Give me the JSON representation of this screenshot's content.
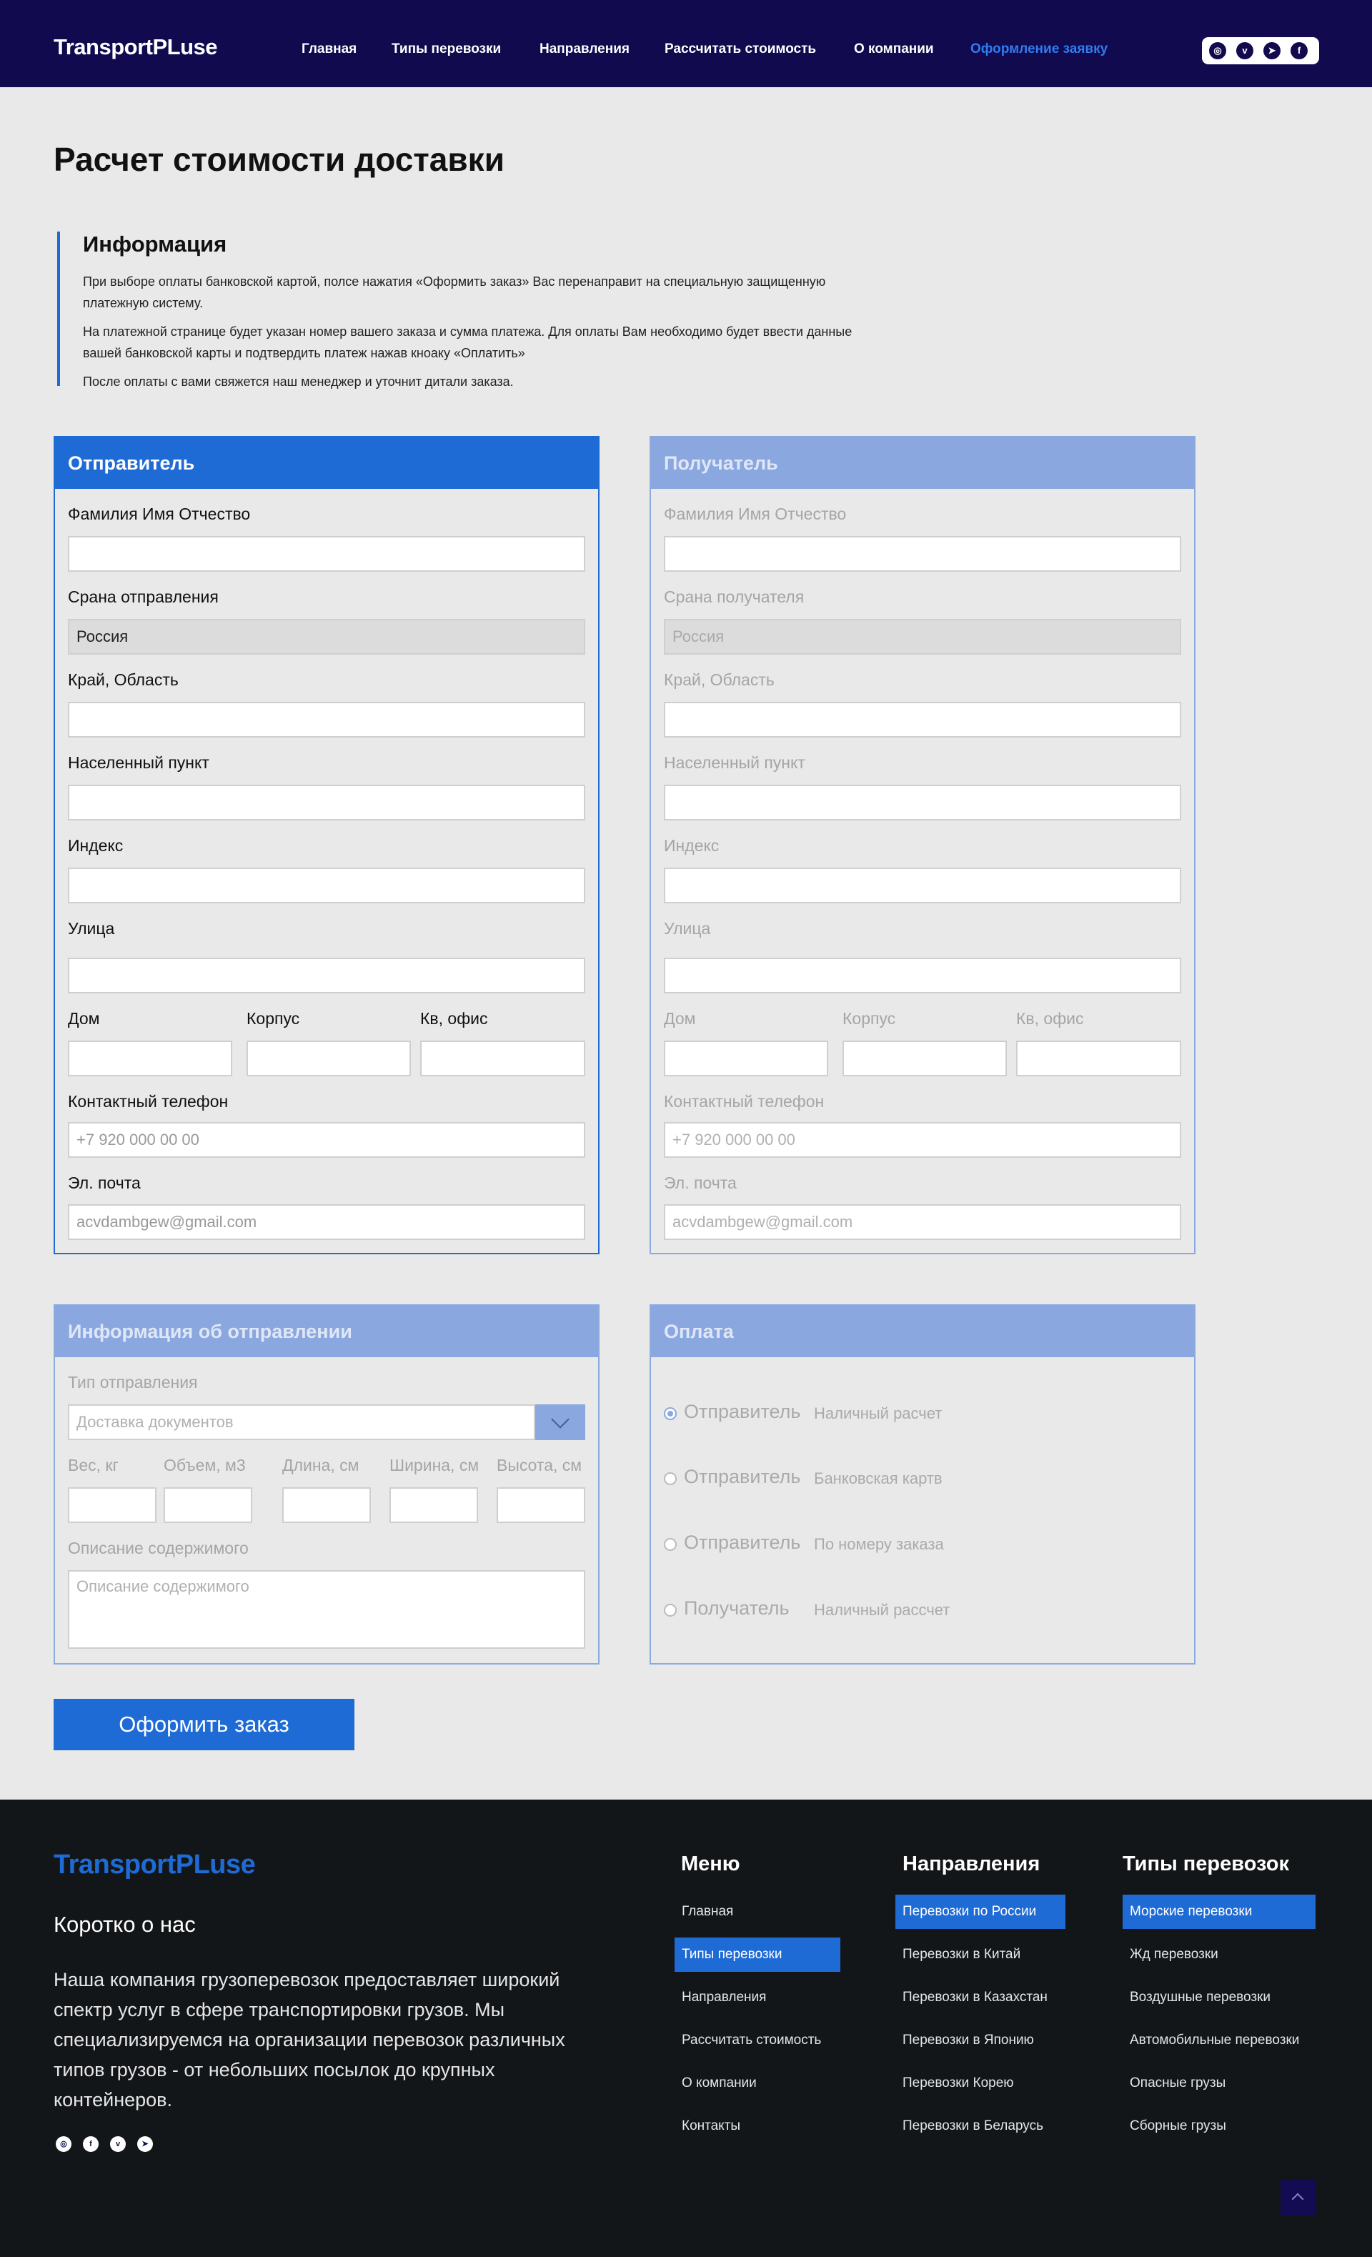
{
  "header": {
    "logo": "TransportPLuse",
    "nav": [
      "Главная",
      "Типы перевозки",
      "Направления",
      "Рассчитать стоимость",
      "О компании",
      "Оформление заявку"
    ],
    "active_nav": "Оформление заявку",
    "social_icons": [
      "instagram-icon",
      "vk-icon",
      "telegram-icon",
      "facebook-icon"
    ]
  },
  "page": {
    "title": "Расчет стоимости доставки",
    "info_title": "Информация",
    "info_paragraphs": [
      "При выборе оплаты банковской картой, полсе нажатия «Оформить заказ» Вас перенаправит на специальную защищенную платежную систему.",
      "На платежной странице будет указан номер вашего заказа и сумма платежа. Для оплаты Вам необходимо будет ввести данные вашей банковской карты и подтвердить платеж нажав кноаку «Оплатить»",
      "После оплаты с вами свяжется наш менеджер и уточнит дитали заказа."
    ]
  },
  "sender": {
    "title": "Отправитель",
    "fio_label": "Фамилия Имя Отчество",
    "country_label": "Срана отправления",
    "country_value": "Россия",
    "region_label": "Край, Область",
    "city_label": "Населенный пункт",
    "index_label": "Индекс",
    "street_label": "Улица",
    "house_label": "Дом",
    "building_label": "Корпус",
    "flat_label": "Кв, офис",
    "phone_label": "Контактный телефон",
    "phone_placeholder": "+7 920 000 00 00",
    "email_label": "Эл. почта",
    "email_placeholder": "acvdambgew@gmail.com"
  },
  "receiver": {
    "title": "Получатель",
    "fio_label": "Фамилия Имя Отчество",
    "country_label": "Срана получателя",
    "country_value": "Россия",
    "region_label": "Край, Область",
    "city_label": "Населенный пункт",
    "index_label": "Индекс",
    "street_label": "Улица",
    "house_label": "Дом",
    "building_label": "Корпус",
    "flat_label": "Кв, офис",
    "phone_label": "Контактный телефон",
    "phone_placeholder": "+7 920 000 00 00",
    "email_label": "Эл. почта",
    "email_placeholder": "acvdambgew@gmail.com"
  },
  "shipment": {
    "title": "Информация об отправлении",
    "type_label": "Тип отправления",
    "type_value": "Доставка документов",
    "weight_label": "Вес, кг",
    "volume_label": "Объем, м3",
    "length_label": "Длина, см",
    "width_label": "Ширина, см",
    "height_label": "Высота, см",
    "desc_label": "Описание содержимого",
    "desc_placeholder": "Описание содержимого"
  },
  "payment": {
    "title": "Оплата",
    "options": [
      {
        "who": "Отправитель",
        "method": "Наличный расчет",
        "selected": true
      },
      {
        "who": "Отправитель",
        "method": "Банковская картв",
        "selected": false
      },
      {
        "who": "Отправитель",
        "method": "По номеру заказа",
        "selected": false
      },
      {
        "who": "Получатель",
        "method": "Наличный рассчет",
        "selected": false
      }
    ]
  },
  "submit_label": "Оформить заказ",
  "footer": {
    "logo": "TransportPLuse",
    "about_title": "Коротко о нас",
    "about_text": "Наша компания грузоперевозок предоставляет широкий спектр услуг в сфере транспортировки грузов. Мы специализируемся на организации перевозок различных типов грузов - от небольших посылок до крупных контейнеров.",
    "menu_title": "Меню",
    "menu": [
      "Главная",
      "Типы перевозки",
      "Направления",
      "Рассчитать стоимость",
      "О компании",
      "Контакты"
    ],
    "directions_title": "Направления",
    "directions": [
      "Перевозки по России",
      "Перевозки в Китай",
      "Перевозки в Казахстан",
      "Перевозки в Японию",
      "Перевозки Корею",
      "Перевозки в Беларусь"
    ],
    "types_title": "Типы перевозок",
    "types": [
      "Морские перевозки",
      "Жд перевозки",
      "Воздушные перевозки",
      "Автомобильные перевозки",
      "Опасные грузы",
      "Сборные грузы"
    ],
    "highlight_color": "#1f6bd6"
  }
}
